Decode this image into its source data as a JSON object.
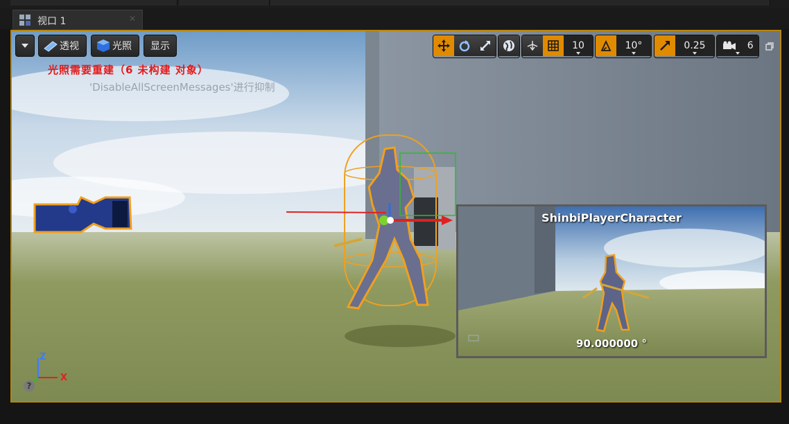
{
  "tab": {
    "title": "视口 1"
  },
  "toolbar": {
    "perspective_label": "透视",
    "lit_label": "光照",
    "show_label": "显示",
    "grid_snap_value": "10",
    "rotate_snap_value": "10°",
    "scale_snap_value": "0.25",
    "camera_speed_value": "6"
  },
  "overlay": {
    "warning_text": "光照需要重建（6 未构建 对象）",
    "hint_text": "'DisableAllScreenMessages'进行抑制"
  },
  "preview": {
    "title": "ShinbiPlayerCharacter",
    "angle": "90.000000 °"
  },
  "axis": {
    "z_label": "Z",
    "x_label": "X"
  },
  "help_label": "?",
  "colors": {
    "accent": "#e08a00",
    "warning": "#e21b1b",
    "selection": "#f0a020"
  }
}
